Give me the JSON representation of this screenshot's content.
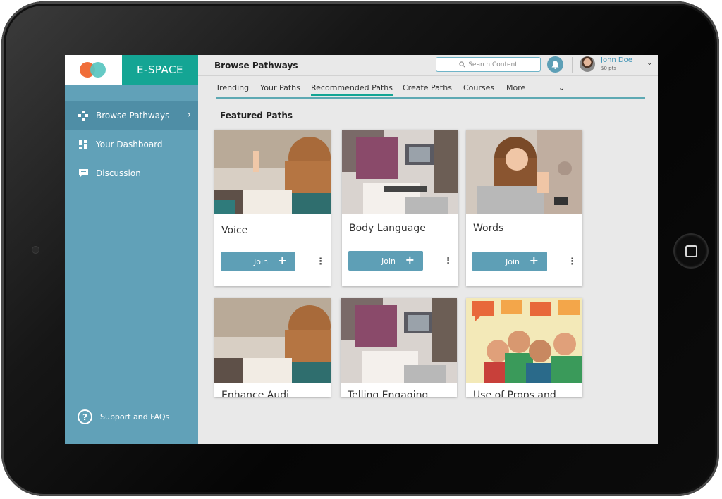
{
  "app": {
    "brand": "E-SPACE"
  },
  "sidebar": {
    "items": [
      {
        "label": "Browse Pathways",
        "icon": "pathways-icon",
        "active": true
      },
      {
        "label": "Your Dashboard",
        "icon": "dashboard-icon",
        "active": false
      },
      {
        "label": "Discussion",
        "icon": "chat-bubble-icon",
        "active": false
      }
    ],
    "support_label": "Support and FAQs"
  },
  "header": {
    "title": "Browse Pathways",
    "search_placeholder": "Search Content",
    "user": {
      "name": "John Doe",
      "points": "$0 pts"
    }
  },
  "tabs": [
    {
      "label": "Trending"
    },
    {
      "label": "Your Paths"
    },
    {
      "label": "Recommended Paths",
      "active": true
    },
    {
      "label": "Create Paths"
    },
    {
      "label": "Courses"
    },
    {
      "label": "More"
    }
  ],
  "section_title": "Featured Paths",
  "cards": [
    {
      "title": "Voice",
      "button": "Join"
    },
    {
      "title": "Body Language",
      "button": "Join"
    },
    {
      "title": "Words",
      "button": "Join"
    },
    {
      "title": "Enhance Audi..."
    },
    {
      "title": "Telling Engaging..."
    },
    {
      "title": "Use of Props and..."
    }
  ],
  "colors": {
    "accent": "#14a594",
    "sidebar": "#61a1b8",
    "button": "#5e9fb6",
    "logo_orange": "#f06e3a",
    "logo_teal": "#58c6c0"
  }
}
